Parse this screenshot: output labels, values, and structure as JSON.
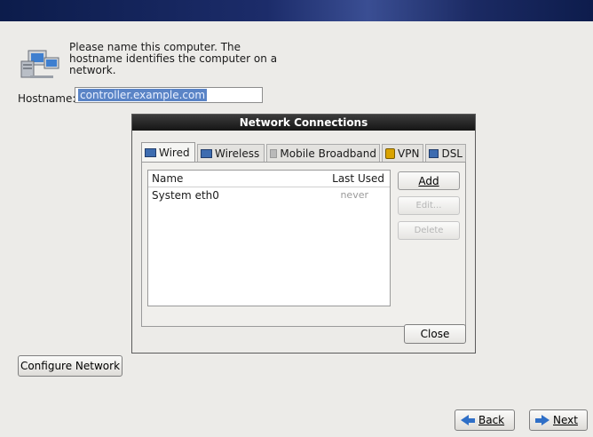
{
  "intro": {
    "line1": "Please name this computer.  The",
    "line2": "hostname identifies the computer on a",
    "line3": "network."
  },
  "hostname": {
    "label": "Hostname:",
    "value": "controller.example.com"
  },
  "dialog": {
    "title": "Network Connections",
    "tabs": [
      {
        "label": "Wired",
        "icon": "wired-icon"
      },
      {
        "label": "Wireless",
        "icon": "wireless-icon"
      },
      {
        "label": "Mobile Broadband",
        "icon": "mobile-broadband-icon"
      },
      {
        "label": "VPN",
        "icon": "lock-icon"
      },
      {
        "label": "DSL",
        "icon": "dsl-icon"
      }
    ],
    "columns": {
      "name": "Name",
      "last_used": "Last Used"
    },
    "rows": [
      {
        "name": "System eth0",
        "last_used": "never"
      }
    ],
    "buttons": {
      "add": "Add",
      "edit": "Edit...",
      "delete": "Delete",
      "close": "Close"
    }
  },
  "configure_network": "Configure Network",
  "nav": {
    "back": "Back",
    "next": "Next"
  },
  "colors": {
    "accent": "#2f6fc7",
    "selection": "#5a84c6"
  }
}
